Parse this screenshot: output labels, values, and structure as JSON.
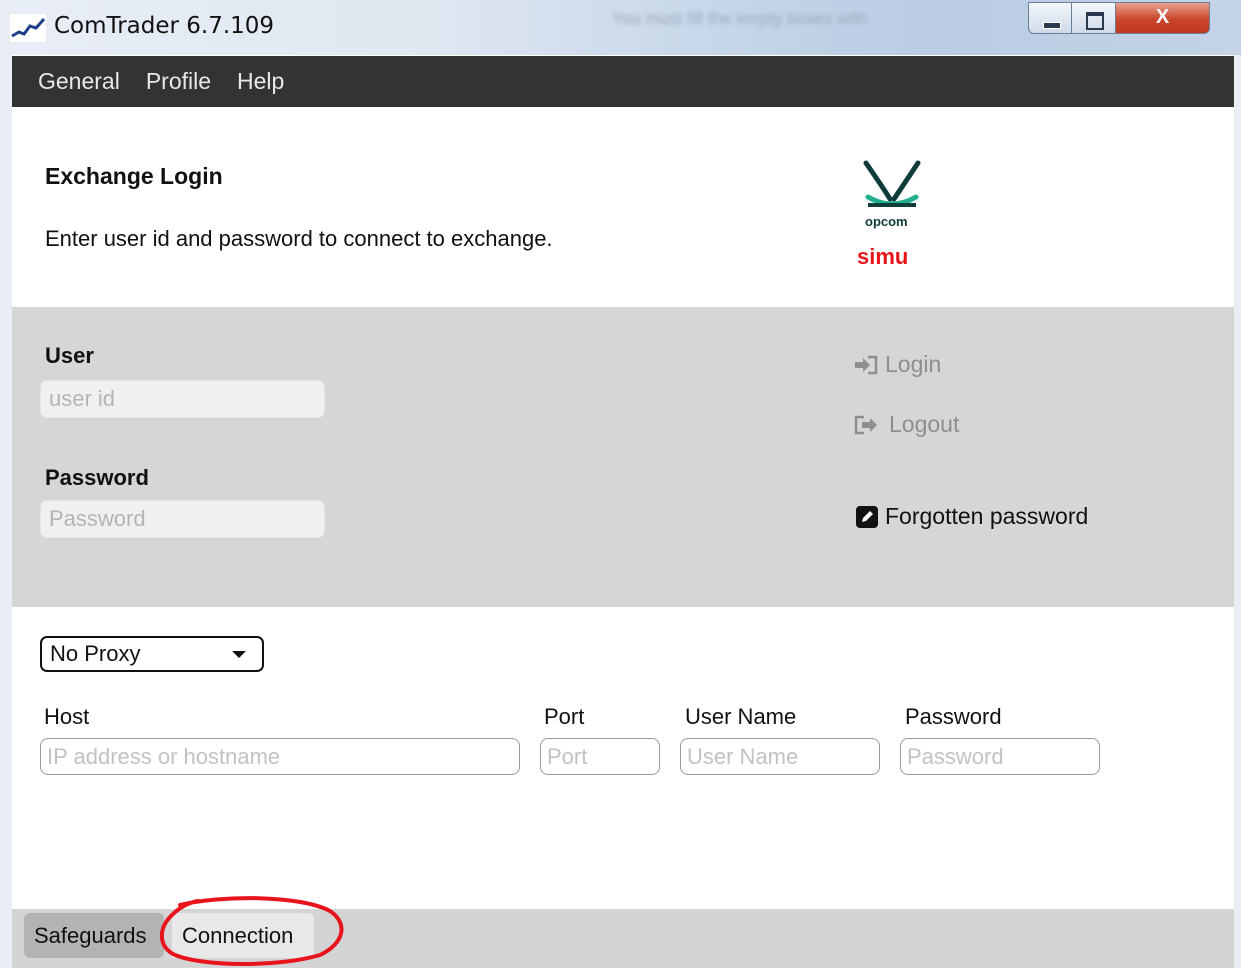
{
  "window": {
    "title": "ComTrader 6.7.109",
    "background_hint": "You must fill the empty boxes with",
    "controls": {
      "close_glyph": "X"
    }
  },
  "menu": {
    "items": [
      {
        "label": "General"
      },
      {
        "label": "Profile"
      },
      {
        "label": "Help"
      }
    ]
  },
  "header": {
    "title": "Exchange Login",
    "subtitle": "Enter user id and password to connect to exchange.",
    "logo_text": "opcom",
    "environment": "simu"
  },
  "login": {
    "user_label": "User",
    "user_placeholder": "user id",
    "password_label": "Password",
    "password_placeholder": "Password",
    "login_label": "Login",
    "logout_label": "Logout",
    "forgot_label": "Forgotten password"
  },
  "proxy": {
    "selected": "No Proxy",
    "host_label": "Host",
    "host_placeholder": "IP address or hostname",
    "port_label": "Port",
    "port_placeholder": "Port",
    "username_label": "User Name",
    "username_placeholder": "User Name",
    "password_label": "Password",
    "password_placeholder": "Password"
  },
  "tabs": [
    {
      "label": "Safeguards",
      "active": false
    },
    {
      "label": "Connection",
      "active": true
    }
  ],
  "colors": {
    "menubar": "#333333",
    "login_panel": "#d6d6d6",
    "env_label": "#e8141b",
    "annotation": "#e8141b"
  }
}
